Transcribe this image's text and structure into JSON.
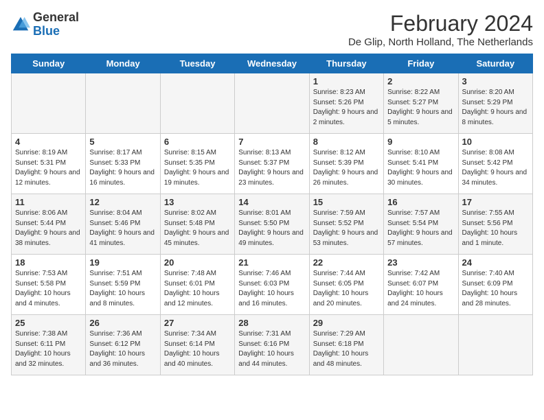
{
  "header": {
    "logo_general": "General",
    "logo_blue": "Blue",
    "title": "February 2024",
    "subtitle": "De Glip, North Holland, The Netherlands"
  },
  "days_of_week": [
    "Sunday",
    "Monday",
    "Tuesday",
    "Wednesday",
    "Thursday",
    "Friday",
    "Saturday"
  ],
  "weeks": [
    [
      {
        "day": "",
        "info": ""
      },
      {
        "day": "",
        "info": ""
      },
      {
        "day": "",
        "info": ""
      },
      {
        "day": "",
        "info": ""
      },
      {
        "day": "1",
        "info": "Sunrise: 8:23 AM\nSunset: 5:26 PM\nDaylight: 9 hours and 2 minutes."
      },
      {
        "day": "2",
        "info": "Sunrise: 8:22 AM\nSunset: 5:27 PM\nDaylight: 9 hours and 5 minutes."
      },
      {
        "day": "3",
        "info": "Sunrise: 8:20 AM\nSunset: 5:29 PM\nDaylight: 9 hours and 8 minutes."
      }
    ],
    [
      {
        "day": "4",
        "info": "Sunrise: 8:19 AM\nSunset: 5:31 PM\nDaylight: 9 hours and 12 minutes."
      },
      {
        "day": "5",
        "info": "Sunrise: 8:17 AM\nSunset: 5:33 PM\nDaylight: 9 hours and 16 minutes."
      },
      {
        "day": "6",
        "info": "Sunrise: 8:15 AM\nSunset: 5:35 PM\nDaylight: 9 hours and 19 minutes."
      },
      {
        "day": "7",
        "info": "Sunrise: 8:13 AM\nSunset: 5:37 PM\nDaylight: 9 hours and 23 minutes."
      },
      {
        "day": "8",
        "info": "Sunrise: 8:12 AM\nSunset: 5:39 PM\nDaylight: 9 hours and 26 minutes."
      },
      {
        "day": "9",
        "info": "Sunrise: 8:10 AM\nSunset: 5:41 PM\nDaylight: 9 hours and 30 minutes."
      },
      {
        "day": "10",
        "info": "Sunrise: 8:08 AM\nSunset: 5:42 PM\nDaylight: 9 hours and 34 minutes."
      }
    ],
    [
      {
        "day": "11",
        "info": "Sunrise: 8:06 AM\nSunset: 5:44 PM\nDaylight: 9 hours and 38 minutes."
      },
      {
        "day": "12",
        "info": "Sunrise: 8:04 AM\nSunset: 5:46 PM\nDaylight: 9 hours and 41 minutes."
      },
      {
        "day": "13",
        "info": "Sunrise: 8:02 AM\nSunset: 5:48 PM\nDaylight: 9 hours and 45 minutes."
      },
      {
        "day": "14",
        "info": "Sunrise: 8:01 AM\nSunset: 5:50 PM\nDaylight: 9 hours and 49 minutes."
      },
      {
        "day": "15",
        "info": "Sunrise: 7:59 AM\nSunset: 5:52 PM\nDaylight: 9 hours and 53 minutes."
      },
      {
        "day": "16",
        "info": "Sunrise: 7:57 AM\nSunset: 5:54 PM\nDaylight: 9 hours and 57 minutes."
      },
      {
        "day": "17",
        "info": "Sunrise: 7:55 AM\nSunset: 5:56 PM\nDaylight: 10 hours and 1 minute."
      }
    ],
    [
      {
        "day": "18",
        "info": "Sunrise: 7:53 AM\nSunset: 5:58 PM\nDaylight: 10 hours and 4 minutes."
      },
      {
        "day": "19",
        "info": "Sunrise: 7:51 AM\nSunset: 5:59 PM\nDaylight: 10 hours and 8 minutes."
      },
      {
        "day": "20",
        "info": "Sunrise: 7:48 AM\nSunset: 6:01 PM\nDaylight: 10 hours and 12 minutes."
      },
      {
        "day": "21",
        "info": "Sunrise: 7:46 AM\nSunset: 6:03 PM\nDaylight: 10 hours and 16 minutes."
      },
      {
        "day": "22",
        "info": "Sunrise: 7:44 AM\nSunset: 6:05 PM\nDaylight: 10 hours and 20 minutes."
      },
      {
        "day": "23",
        "info": "Sunrise: 7:42 AM\nSunset: 6:07 PM\nDaylight: 10 hours and 24 minutes."
      },
      {
        "day": "24",
        "info": "Sunrise: 7:40 AM\nSunset: 6:09 PM\nDaylight: 10 hours and 28 minutes."
      }
    ],
    [
      {
        "day": "25",
        "info": "Sunrise: 7:38 AM\nSunset: 6:11 PM\nDaylight: 10 hours and 32 minutes."
      },
      {
        "day": "26",
        "info": "Sunrise: 7:36 AM\nSunset: 6:12 PM\nDaylight: 10 hours and 36 minutes."
      },
      {
        "day": "27",
        "info": "Sunrise: 7:34 AM\nSunset: 6:14 PM\nDaylight: 10 hours and 40 minutes."
      },
      {
        "day": "28",
        "info": "Sunrise: 7:31 AM\nSunset: 6:16 PM\nDaylight: 10 hours and 44 minutes."
      },
      {
        "day": "29",
        "info": "Sunrise: 7:29 AM\nSunset: 6:18 PM\nDaylight: 10 hours and 48 minutes."
      },
      {
        "day": "",
        "info": ""
      },
      {
        "day": "",
        "info": ""
      }
    ]
  ]
}
